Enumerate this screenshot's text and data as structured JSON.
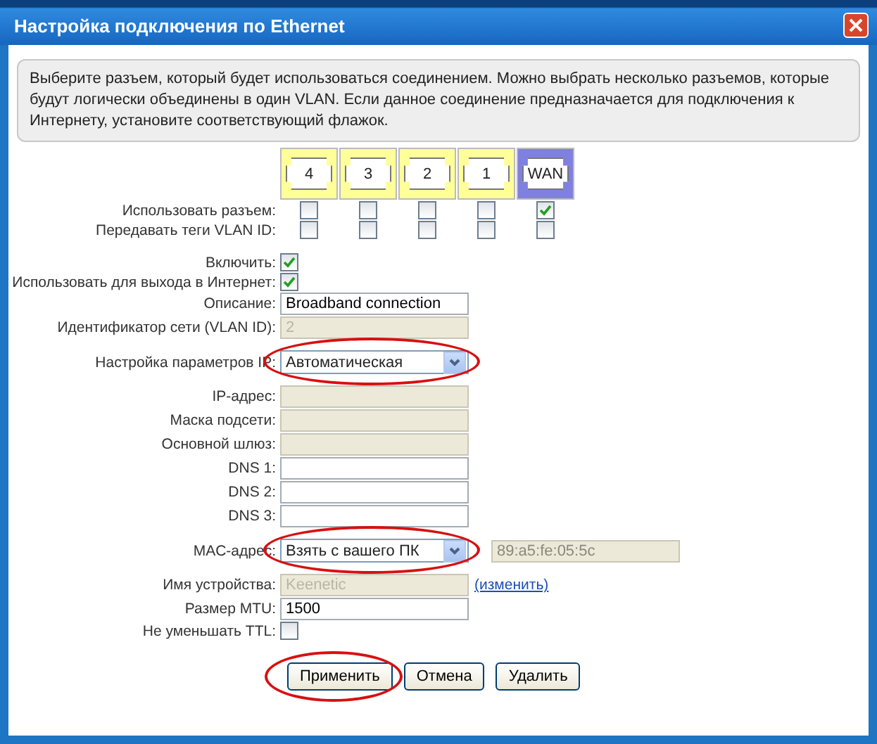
{
  "window": {
    "title": "Настройка подключения по Ethernet"
  },
  "info": "Выберите разъем, который будет использоваться соединением. Можно выбрать несколько разъемов, которые будут логически объединены в один VLAN. Если данное соединение предназначается для подключения к Интернету, установите соответствующий флажок.",
  "port_rows": [
    "Использовать разъем:",
    "Передавать теги VLAN ID:"
  ],
  "ports": [
    {
      "label": "4",
      "selected": false,
      "use": false,
      "vlan_tags": false
    },
    {
      "label": "3",
      "selected": false,
      "use": false,
      "vlan_tags": false
    },
    {
      "label": "2",
      "selected": false,
      "use": false,
      "vlan_tags": false
    },
    {
      "label": "1",
      "selected": false,
      "use": false,
      "vlan_tags": false
    },
    {
      "label": "WAN",
      "selected": true,
      "use": true,
      "vlan_tags": false
    }
  ],
  "fields": [
    {
      "kind": "checkbox",
      "label": "Включить:",
      "checked": true
    },
    {
      "kind": "checkbox",
      "label": "Использовать для выхода в Интернет:",
      "checked": true
    },
    {
      "kind": "text",
      "label": "Описание:",
      "value": "Broadband connection",
      "disabled": false
    },
    {
      "kind": "text",
      "label": "Идентификатор сети (VLAN ID):",
      "value": "2",
      "disabled": true
    },
    {
      "kind": "select",
      "label": "Настройка параметров IP:",
      "value": "Автоматическая",
      "circled": true
    },
    {
      "kind": "text",
      "label": "IP-адрес:",
      "disabled": true
    },
    {
      "kind": "text",
      "label": "Маска подсети:",
      "disabled": true
    },
    {
      "kind": "text",
      "label": "Основной шлюз:",
      "disabled": true
    },
    {
      "kind": "text",
      "label": "DNS 1:",
      "disabled": false
    },
    {
      "kind": "text",
      "label": "DNS 2:",
      "disabled": false
    },
    {
      "kind": "text",
      "label": "DNS 3:",
      "disabled": false
    },
    {
      "kind": "select",
      "label": "MAC-адрес:",
      "value": "Взять с вашего ПК",
      "circled": true,
      "extra_value": "89:a5:fe:05:5c"
    },
    {
      "kind": "text",
      "label": "Имя устройства:",
      "value": "Keenetic",
      "disabled": true,
      "link": "(изменить)"
    },
    {
      "kind": "text",
      "label": "Размер MTU:",
      "value": "1500",
      "disabled": false
    },
    {
      "kind": "checkbox",
      "label": "Не уменьшать TTL:",
      "checked": false
    }
  ],
  "buttons": [
    {
      "label": "Применить",
      "circled": true
    },
    {
      "label": "Отмена",
      "circled": false
    },
    {
      "label": "Удалить",
      "circled": false
    }
  ]
}
